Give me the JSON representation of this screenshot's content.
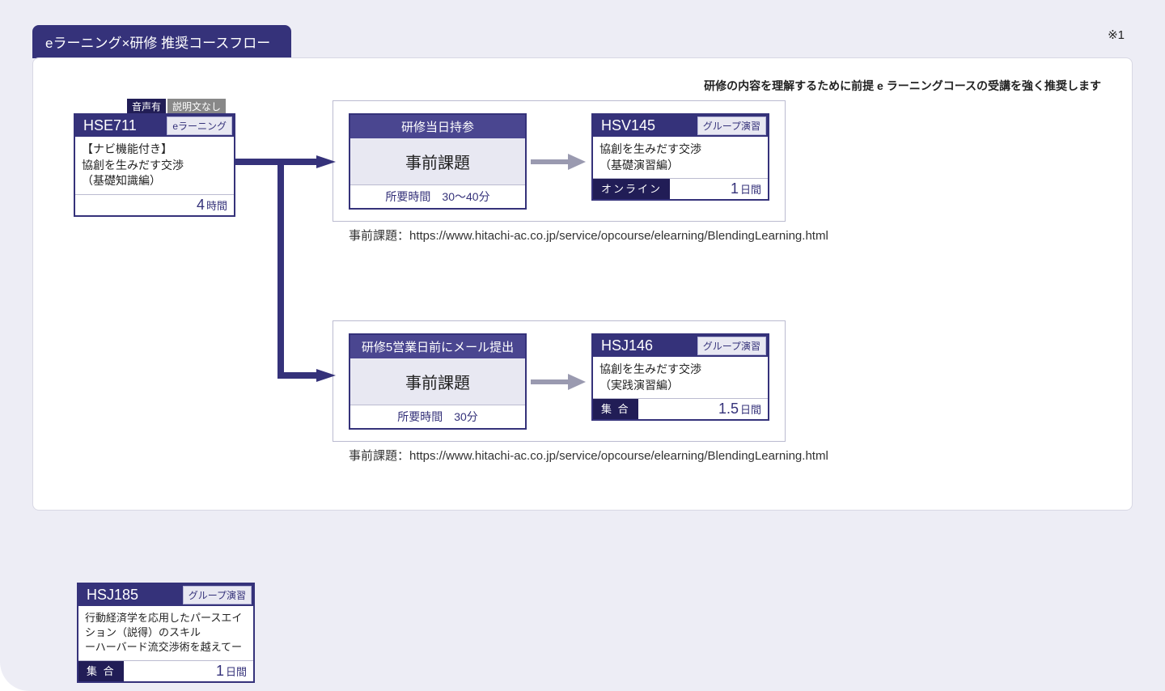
{
  "header": {
    "tab": "eラーニング×研修 推奨コースフロー",
    "note": "※1",
    "recommend": "研修の内容を理解するために前提 e ラーニングコースの受講を強く推奨します"
  },
  "pills": {
    "a": "音声有",
    "b": "説明文なし"
  },
  "cardA": {
    "code": "HSE711",
    "tag": "eラーニング",
    "body": "【ナビ機能付き】\n協創を生みだす交渉\n（基礎知識編）",
    "dur_n": "4",
    "dur_u": "時間"
  },
  "task1": {
    "hdr": "研修当日持参",
    "body": "事前課題",
    "ftr": "所要時間　30～40分"
  },
  "cardB": {
    "code": "HSV145",
    "tag": "グループ演習",
    "body": "協創を生みだす交渉\n（基礎演習編）",
    "mode": "オンライン",
    "dur_n": "1",
    "dur_u": "日間"
  },
  "caption1": "事前課題：https://www.hitachi-ac.co.jp/service/opcourse/elearning/BlendingLearning.html",
  "task2": {
    "hdr": "研修5営業日前にメール提出",
    "body": "事前課題",
    "ftr": "所要時間　30分"
  },
  "cardC": {
    "code": "HSJ146",
    "tag": "グループ演習",
    "body": "協創を生みだす交渉\n（実践演習編）",
    "mode": "集 合",
    "dur_n": "1.5",
    "dur_u": "日間"
  },
  "caption2": "事前課題：https://www.hitachi-ac.co.jp/service/opcourse/elearning/BlendingLearning.html",
  "cardD": {
    "code": "HSJ185",
    "tag": "グループ演習",
    "body": "行動経済学を応用したパースエイション（説得）のスキル\nーハーバード流交渉術を越えてー",
    "mode": "集 合",
    "dur_n": "1",
    "dur_u": "日間"
  }
}
